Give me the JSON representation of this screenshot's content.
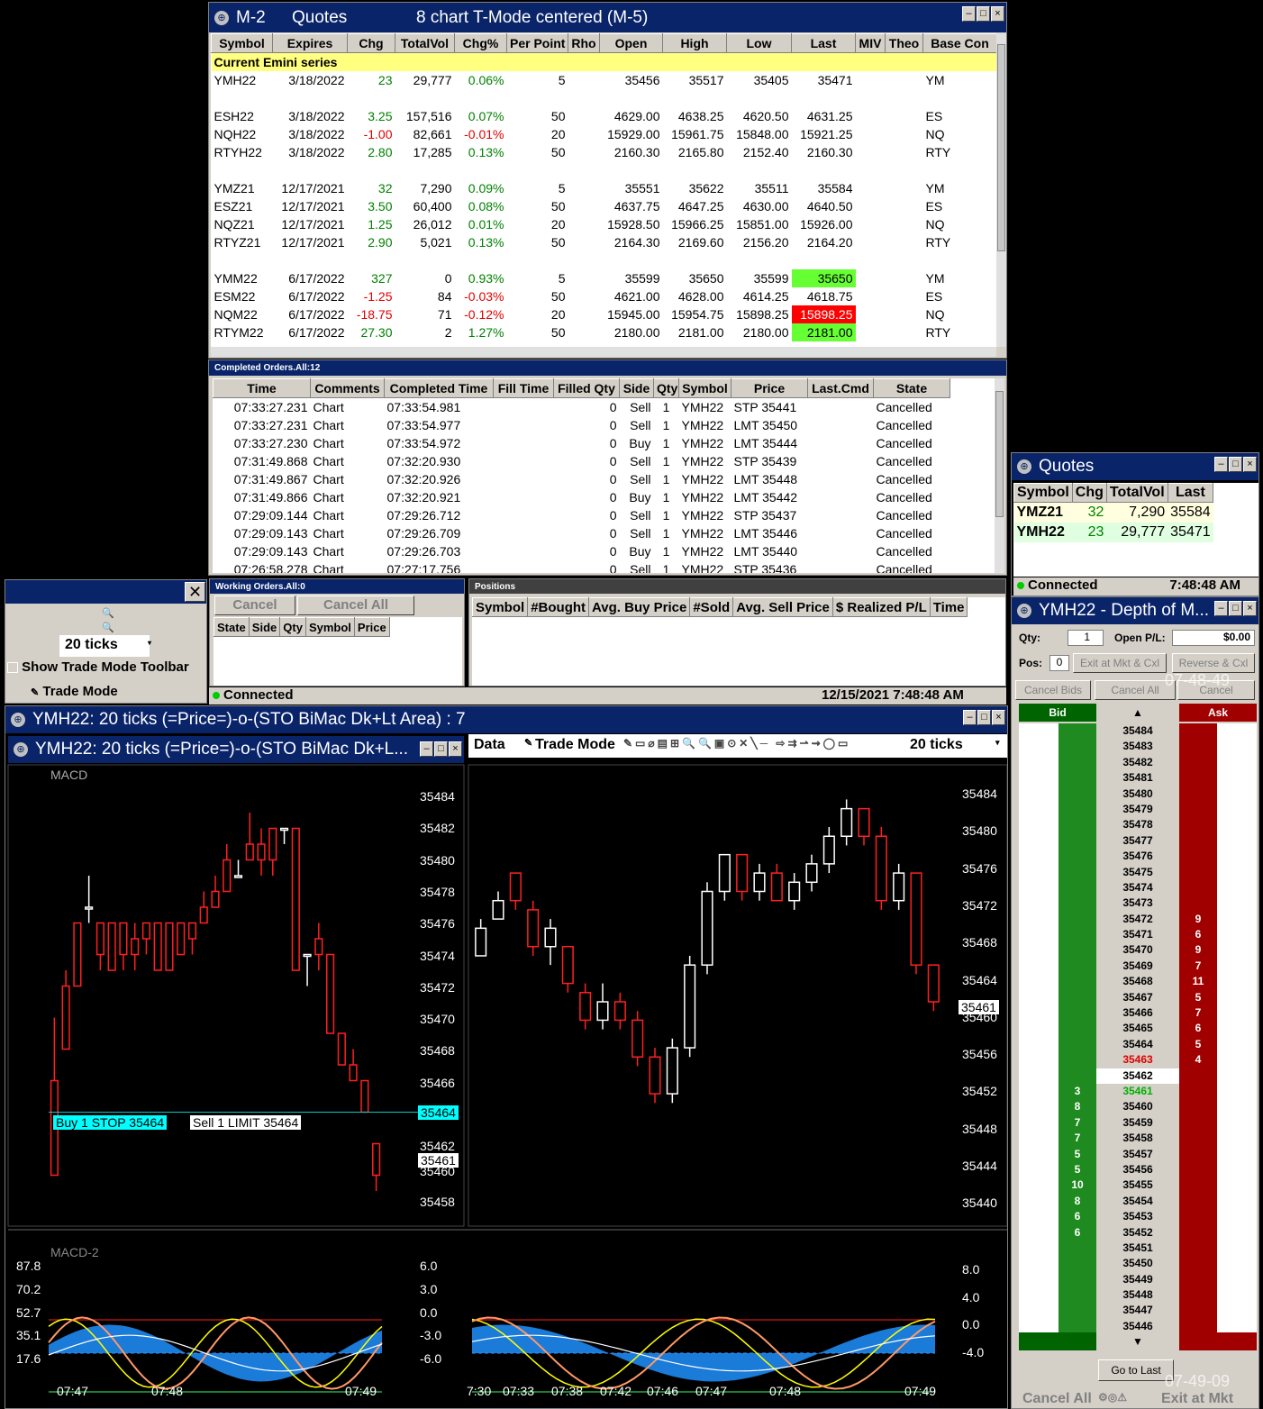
{
  "quotes_window": {
    "title_code": "M-2",
    "title_name": "Quotes",
    "title_desc": "8 chart T-Mode centered (M-5)",
    "columns": [
      "Symbol",
      "Expires",
      "Chg",
      "TotalVol",
      "Chg%",
      "Per Point",
      "Rho",
      "Open",
      "High",
      "Low",
      "Last",
      "MIV",
      "Theo",
      "Base Con"
    ],
    "section_label": "Current Emini series",
    "rows": [
      {
        "symbol": "YMH22",
        "expires": "3/18/2022",
        "chg": "23",
        "vol": "29,777",
        "pct": "0.06%",
        "pp": "5",
        "open": "35456",
        "high": "35517",
        "low": "35405",
        "last": "35471",
        "base": "YM",
        "dir": "pos",
        "hl": ""
      },
      {
        "symbol": "",
        "expires": "",
        "chg": "",
        "vol": "",
        "pct": "",
        "pp": "",
        "open": "",
        "high": "",
        "low": "",
        "last": "",
        "base": "",
        "dir": "",
        "hl": ""
      },
      {
        "symbol": "ESH22",
        "expires": "3/18/2022",
        "chg": "3.25",
        "vol": "157,516",
        "pct": "0.07%",
        "pp": "50",
        "open": "4629.00",
        "high": "4638.25",
        "low": "4620.50",
        "last": "4631.25",
        "base": "ES",
        "dir": "pos",
        "hl": ""
      },
      {
        "symbol": "NQH22",
        "expires": "3/18/2022",
        "chg": "-1.00",
        "vol": "82,661",
        "pct": "-0.01%",
        "pp": "20",
        "open": "15929.00",
        "high": "15961.75",
        "low": "15848.00",
        "last": "15921.25",
        "base": "NQ",
        "dir": "neg",
        "hl": ""
      },
      {
        "symbol": "RTYH22",
        "expires": "3/18/2022",
        "chg": "2.80",
        "vol": "17,285",
        "pct": "0.13%",
        "pp": "50",
        "open": "2160.30",
        "high": "2165.80",
        "low": "2152.40",
        "last": "2160.30",
        "base": "RTY",
        "dir": "pos",
        "hl": ""
      },
      {
        "symbol": "",
        "expires": "",
        "chg": "",
        "vol": "",
        "pct": "",
        "pp": "",
        "open": "",
        "high": "",
        "low": "",
        "last": "",
        "base": "",
        "dir": "",
        "hl": ""
      },
      {
        "symbol": "YMZ21",
        "expires": "12/17/2021",
        "chg": "32",
        "vol": "7,290",
        "pct": "0.09%",
        "pp": "5",
        "open": "35551",
        "high": "35622",
        "low": "35511",
        "last": "35584",
        "base": "YM",
        "dir": "pos",
        "hl": ""
      },
      {
        "symbol": "ESZ21",
        "expires": "12/17/2021",
        "chg": "3.50",
        "vol": "60,400",
        "pct": "0.08%",
        "pp": "50",
        "open": "4637.75",
        "high": "4647.25",
        "low": "4630.00",
        "last": "4640.50",
        "base": "ES",
        "dir": "pos",
        "hl": ""
      },
      {
        "symbol": "NQZ21",
        "expires": "12/17/2021",
        "chg": "1.25",
        "vol": "26,012",
        "pct": "0.01%",
        "pp": "20",
        "open": "15928.50",
        "high": "15966.25",
        "low": "15851.00",
        "last": "15926.00",
        "base": "NQ",
        "dir": "pos",
        "hl": ""
      },
      {
        "symbol": "RTYZ21",
        "expires": "12/17/2021",
        "chg": "2.90",
        "vol": "5,021",
        "pct": "0.13%",
        "pp": "50",
        "open": "2164.30",
        "high": "2169.60",
        "low": "2156.20",
        "last": "2164.20",
        "base": "RTY",
        "dir": "pos",
        "hl": ""
      },
      {
        "symbol": "",
        "expires": "",
        "chg": "",
        "vol": "",
        "pct": "",
        "pp": "",
        "open": "",
        "high": "",
        "low": "",
        "last": "",
        "base": "",
        "dir": "",
        "hl": ""
      },
      {
        "symbol": "YMM22",
        "expires": "6/17/2022",
        "chg": "327",
        "vol": "0",
        "pct": "0.93%",
        "pp": "5",
        "open": "35599",
        "high": "35650",
        "low": "35599",
        "last": "35650",
        "base": "YM",
        "dir": "pos",
        "hl": "green"
      },
      {
        "symbol": "ESM22",
        "expires": "6/17/2022",
        "chg": "-1.25",
        "vol": "84",
        "pct": "-0.03%",
        "pp": "50",
        "open": "4621.00",
        "high": "4628.00",
        "low": "4614.25",
        "last": "4618.75",
        "base": "ES",
        "dir": "neg",
        "hl": ""
      },
      {
        "symbol": "NQM22",
        "expires": "6/17/2022",
        "chg": "-18.75",
        "vol": "71",
        "pct": "-0.12%",
        "pp": "20",
        "open": "15945.00",
        "high": "15954.75",
        "low": "15898.25",
        "last": "15898.25",
        "base": "NQ",
        "dir": "neg",
        "hl": "red"
      },
      {
        "symbol": "RTYM22",
        "expires": "6/17/2022",
        "chg": "27.30",
        "vol": "2",
        "pct": "1.27%",
        "pp": "50",
        "open": "2180.00",
        "high": "2181.00",
        "low": "2180.00",
        "last": "2181.00",
        "base": "RTY",
        "dir": "pos",
        "hl": "green"
      }
    ]
  },
  "completed_orders": {
    "title": "Completed Orders.All:12",
    "columns": [
      "Time",
      "Comments",
      "Completed Time",
      "Fill Time",
      "Filled Qty",
      "Side",
      "Qty",
      "Symbol",
      "Price",
      "Last.Cmd",
      "State"
    ],
    "rows": [
      {
        "time": "07:33:27.231",
        "comments": "Chart",
        "completed": "07:33:54.981",
        "filled": "0",
        "side": "Sell",
        "qty": "1",
        "symbol": "YMH22",
        "price": "STP 35441",
        "state": "Cancelled"
      },
      {
        "time": "07:33:27.231",
        "comments": "Chart",
        "completed": "07:33:54.977",
        "filled": "0",
        "side": "Sell",
        "qty": "1",
        "symbol": "YMH22",
        "price": "LMT 35450",
        "state": "Cancelled"
      },
      {
        "time": "07:33:27.230",
        "comments": "Chart",
        "completed": "07:33:54.972",
        "filled": "0",
        "side": "Buy",
        "qty": "1",
        "symbol": "YMH22",
        "price": "LMT 35444",
        "state": "Cancelled"
      },
      {
        "time": "07:31:49.868",
        "comments": "Chart",
        "completed": "07:32:20.930",
        "filled": "0",
        "side": "Sell",
        "qty": "1",
        "symbol": "YMH22",
        "price": "STP 35439",
        "state": "Cancelled"
      },
      {
        "time": "07:31:49.867",
        "comments": "Chart",
        "completed": "07:32:20.926",
        "filled": "0",
        "side": "Sell",
        "qty": "1",
        "symbol": "YMH22",
        "price": "LMT 35448",
        "state": "Cancelled"
      },
      {
        "time": "07:31:49.866",
        "comments": "Chart",
        "completed": "07:32:20.921",
        "filled": "0",
        "side": "Buy",
        "qty": "1",
        "symbol": "YMH22",
        "price": "LMT 35442",
        "state": "Cancelled"
      },
      {
        "time": "07:29:09.144",
        "comments": "Chart",
        "completed": "07:29:26.712",
        "filled": "0",
        "side": "Sell",
        "qty": "1",
        "symbol": "YMH22",
        "price": "STP 35437",
        "state": "Cancelled"
      },
      {
        "time": "07:29:09.143",
        "comments": "Chart",
        "completed": "07:29:26.709",
        "filled": "0",
        "side": "Sell",
        "qty": "1",
        "symbol": "YMH22",
        "price": "LMT 35446",
        "state": "Cancelled"
      },
      {
        "time": "07:29:09.143",
        "comments": "Chart",
        "completed": "07:29:26.703",
        "filled": "0",
        "side": "Buy",
        "qty": "1",
        "symbol": "YMH22",
        "price": "LMT 35440",
        "state": "Cancelled"
      },
      {
        "time": "07:26:58.278",
        "comments": "Chart",
        "completed": "07:27:17.756",
        "filled": "0",
        "side": "Sell",
        "qty": "1",
        "symbol": "YMH22",
        "price": "STP 35436",
        "state": "Cancelled"
      }
    ]
  },
  "small_quotes": {
    "title": "Quotes",
    "columns": [
      "Symbol",
      "Chg",
      "TotalVol",
      "Last"
    ],
    "rows": [
      {
        "symbol": "YMZ21",
        "chg": "32",
        "vol": "7,290",
        "last": "35584"
      },
      {
        "symbol": "YMH22",
        "chg": "23",
        "vol": "29,777",
        "last": "35471"
      }
    ],
    "status": "Connected",
    "time": "7:48:48 AM"
  },
  "toolbar_panel": {
    "ticks_value": "20 ticks",
    "show_toolbar": "Show Trade Mode Toolbar",
    "trade_mode": "Trade Mode",
    "close": "✕"
  },
  "working_orders": {
    "title": "Working Orders.All:0",
    "cancel": "Cancel",
    "cancel_all": "Cancel All",
    "columns": [
      "State",
      "Side",
      "Qty",
      "Symbol",
      "Price"
    ]
  },
  "positions": {
    "title": "Positions",
    "columns": [
      "Symbol",
      "#Bought",
      "Avg. Buy Price",
      "#Sold",
      "Avg. Sell Price",
      "$ Realized P/L",
      "Time"
    ]
  },
  "status_bar": {
    "status": "Connected",
    "datetime": "12/15/2021 7:48:48 AM"
  },
  "dom": {
    "title": "YMH22 - Depth of M...",
    "qty_label": "Qty:",
    "qty_value": "1",
    "openpl_label": "Open P/L:",
    "openpl_value": "$0.00",
    "pos_label": "Pos:",
    "pos_value": "0",
    "exit_cxl": "Exit at Mkt & Cxl",
    "reverse_cxl": "Reverse & Cxl",
    "cancel_bids": "Cancel Bids",
    "cancel_all": "Cancel All",
    "cancel": "Cancel",
    "timestamp_top": "07-48-49",
    "bid_header": "Bid",
    "ask_header": "Ask",
    "go_to_last": "Go to Last",
    "timestamp_bottom": "07-49-09",
    "bottom_cancel_all": "Cancel All",
    "bottom_exit": "Exit at Mkt",
    "last_price": "35461",
    "ladder": [
      {
        "p": "35484",
        "b": "",
        "a": ""
      },
      {
        "p": "35483",
        "b": "",
        "a": ""
      },
      {
        "p": "35482",
        "b": "",
        "a": ""
      },
      {
        "p": "35481",
        "b": "",
        "a": ""
      },
      {
        "p": "35480",
        "b": "",
        "a": ""
      },
      {
        "p": "35479",
        "b": "",
        "a": ""
      },
      {
        "p": "35478",
        "b": "",
        "a": ""
      },
      {
        "p": "35477",
        "b": "",
        "a": ""
      },
      {
        "p": "35476",
        "b": "",
        "a": ""
      },
      {
        "p": "35475",
        "b": "",
        "a": ""
      },
      {
        "p": "35474",
        "b": "",
        "a": ""
      },
      {
        "p": "35473",
        "b": "",
        "a": ""
      },
      {
        "p": "35472",
        "b": "",
        "a": "9"
      },
      {
        "p": "35471",
        "b": "",
        "a": "6"
      },
      {
        "p": "35470",
        "b": "",
        "a": "9"
      },
      {
        "p": "35469",
        "b": "",
        "a": "7"
      },
      {
        "p": "35468",
        "b": "",
        "a": "11"
      },
      {
        "p": "35467",
        "b": "",
        "a": "5"
      },
      {
        "p": "35466",
        "b": "",
        "a": "7"
      },
      {
        "p": "35465",
        "b": "",
        "a": "6"
      },
      {
        "p": "35464",
        "b": "",
        "a": "5"
      },
      {
        "p": "35463",
        "b": "",
        "a": "4"
      },
      {
        "p": "35462",
        "b": "",
        "a": ""
      },
      {
        "p": "35461",
        "b": "3",
        "a": ""
      },
      {
        "p": "35460",
        "b": "8",
        "a": ""
      },
      {
        "p": "35459",
        "b": "7",
        "a": ""
      },
      {
        "p": "35458",
        "b": "7",
        "a": ""
      },
      {
        "p": "35457",
        "b": "5",
        "a": ""
      },
      {
        "p": "35456",
        "b": "5",
        "a": ""
      },
      {
        "p": "35455",
        "b": "10",
        "a": ""
      },
      {
        "p": "35454",
        "b": "8",
        "a": ""
      },
      {
        "p": "35453",
        "b": "6",
        "a": ""
      },
      {
        "p": "35452",
        "b": "6",
        "a": ""
      },
      {
        "p": "35451",
        "b": "",
        "a": ""
      },
      {
        "p": "35450",
        "b": "",
        "a": ""
      },
      {
        "p": "35449",
        "b": "",
        "a": ""
      },
      {
        "p": "35448",
        "b": "",
        "a": ""
      },
      {
        "p": "35447",
        "b": "",
        "a": ""
      },
      {
        "p": "35446",
        "b": "",
        "a": ""
      }
    ]
  },
  "chart_outer": {
    "title": "YMH22: 20 ticks (=Price=)-o-(STO BiMac Dk+Lt Area) : 7"
  },
  "chart_left": {
    "title": "YMH22: 20 ticks (=Price=)-o-(STO BiMac Dk+L...",
    "macd_label": "MACD",
    "macd2_label": "MACD-2",
    "buy_tag": "Buy 1 STOP 35464",
    "sell_tag": "Sell 1 LIMIT 35464",
    "order_price_tag": "35464",
    "last_tag": "35461",
    "y_labels": [
      "35484",
      "35482",
      "35480",
      "35478",
      "35476",
      "35474",
      "35472",
      "35470",
      "35468",
      "35466",
      "35462",
      "35460",
      "35458"
    ],
    "osc_left_labels": [
      "87.8",
      "70.2",
      "52.7",
      "35.1",
      "17.6"
    ],
    "osc_right_labels": [
      "6.0",
      "3.0",
      "0.0",
      "-3.0",
      "-6.0"
    ],
    "x_labels": [
      "07:47",
      "07:48",
      "07:49"
    ]
  },
  "chart_right": {
    "data_label": "Data",
    "trade_mode": "Trade Mode",
    "ticks": "20 ticks",
    "last_tag": "35461",
    "y_labels": [
      "35484",
      "35480",
      "35476",
      "35472",
      "35468",
      "35464",
      "35460",
      "35456",
      "35452",
      "35448",
      "35444",
      "35440"
    ],
    "osc_labels": [
      "8.0",
      "4.0",
      "0.0",
      "-4.0"
    ],
    "x_labels": [
      "7:30",
      "07:33",
      "07:38",
      "07:42",
      "07:46",
      "07:47",
      "07:48",
      "07:49"
    ]
  },
  "chart_data": [
    {
      "type": "candlestick",
      "title": "YMH22: 20 ticks",
      "ylim": [
        35457,
        35485
      ],
      "candles": [
        [
          35466,
          35460,
          35470,
          35460
        ],
        [
          35472,
          35468,
          35473,
          35469
        ],
        [
          35476,
          35472,
          35476,
          35472
        ],
        [
          35477,
          35477,
          35479,
          35476
        ],
        [
          35476,
          35474,
          35476,
          35473
        ],
        [
          35476,
          35473,
          35476,
          35473
        ],
        [
          35476,
          35474,
          35476,
          35473
        ],
        [
          35475,
          35474,
          35476,
          35473
        ],
        [
          35476,
          35475,
          35476,
          35474
        ],
        [
          35476,
          35473,
          35476,
          35473
        ],
        [
          35476,
          35473,
          35476,
          35473
        ],
        [
          35476,
          35474,
          35476,
          35474
        ],
        [
          35476,
          35475,
          35476,
          35474
        ],
        [
          35477,
          35476,
          35478,
          35476
        ],
        [
          35478,
          35477,
          35479,
          35477
        ],
        [
          35480,
          35478,
          35481,
          35478
        ],
        [
          35479,
          35479,
          35480,
          35479
        ],
        [
          35481,
          35480,
          35483,
          35480
        ],
        [
          35481,
          35480,
          35482,
          35479
        ],
        [
          35482,
          35480,
          35482,
          35479
        ],
        [
          35482,
          35482,
          35482,
          35481
        ],
        [
          35482,
          35473,
          35482,
          35473
        ],
        [
          35474,
          35474,
          35474,
          35472
        ],
        [
          35475,
          35474,
          35476,
          35473
        ],
        [
          35474,
          35469,
          35474,
          35469
        ],
        [
          35469,
          35467,
          35469,
          35467
        ],
        [
          35467,
          35466,
          35468,
          35466
        ],
        [
          35466,
          35464,
          35466,
          35464
        ],
        [
          35462,
          35460,
          35462,
          35459
        ]
      ],
      "order_lines": [
        35464
      ],
      "last": 35461
    },
    {
      "type": "candlestick",
      "title": "YMH22: 20 ticks",
      "ylim": [
        35438,
        35486
      ],
      "candles": [
        [
          35467,
          35470,
          35467,
          35471
        ],
        [
          35471,
          35473,
          35471,
          35474
        ],
        [
          35476,
          35473,
          35476,
          35472
        ],
        [
          35472,
          35468,
          35473,
          35467
        ],
        [
          35468,
          35470,
          35466,
          35471
        ],
        [
          35468,
          35464,
          35468,
          35463
        ],
        [
          35463,
          35460,
          35464,
          35459
        ],
        [
          35460,
          35462,
          35459,
          35464
        ],
        [
          35462,
          35460,
          35463,
          35459
        ],
        [
          35460,
          35456,
          35461,
          35455
        ],
        [
          35456,
          35452,
          35457,
          35451
        ],
        [
          35452,
          35457,
          35451,
          35458
        ],
        [
          35457,
          35466,
          35456,
          35467
        ],
        [
          35466,
          35474,
          35465,
          35475
        ],
        [
          35474,
          35478,
          35473,
          35478
        ],
        [
          35478,
          35474,
          35478,
          35473
        ],
        [
          35474,
          35476,
          35473,
          35477
        ],
        [
          35476,
          35473,
          35477,
          35473
        ],
        [
          35473,
          35475,
          35472,
          35476
        ],
        [
          35475,
          35477,
          35474,
          35478
        ],
        [
          35477,
          35480,
          35476,
          35481
        ],
        [
          35480,
          35483,
          35479,
          35484
        ],
        [
          35483,
          35480,
          35483,
          35479
        ],
        [
          35480,
          35473,
          35481,
          35472
        ],
        [
          35473,
          35476,
          35472,
          35477
        ],
        [
          35476,
          35466,
          35476,
          35465
        ],
        [
          35466,
          35462,
          35466,
          35461
        ]
      ],
      "last": 35461
    }
  ]
}
